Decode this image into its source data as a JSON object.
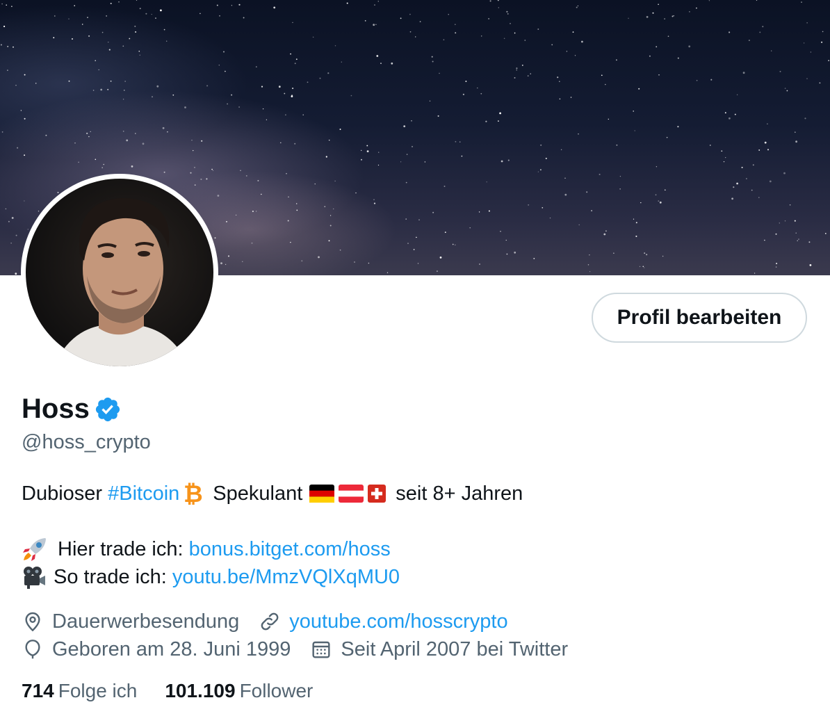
{
  "profile": {
    "name": "Hoss",
    "handle": "@hoss_crypto",
    "edit_button_label": "Profil bearbeiten"
  },
  "bio": {
    "line1_prefix": "Dubioser ",
    "hashtag": "#Bitcoin",
    "line1_mid": "Spekulant",
    "line1_suffix": "seit 8+ Jahren",
    "line2_label": "Hier trade ich: ",
    "line2_link": "bonus.bitget.com/hoss",
    "line3_label": "So trade ich: ",
    "line3_link": "youtu.be/MmzVQlXqMU0"
  },
  "meta": {
    "location": "Dauerwerbesendung",
    "website": "youtube.com/hosscrypto",
    "birthday": "Geboren am 28. Juni 1999",
    "joined": "Seit April 2007 bei Twitter"
  },
  "stats": {
    "following_count": "714",
    "following_label": "Folge ich",
    "followers_count": "101.109",
    "followers_label": "Follower"
  },
  "colors": {
    "link": "#1d9bf0",
    "text": "#0f1419",
    "secondary": "#536471",
    "verified": "#1d9bf0",
    "bitcoin": "#f7931a"
  }
}
